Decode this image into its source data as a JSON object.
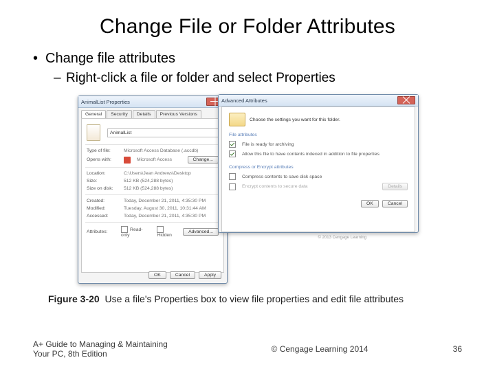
{
  "title": "Change File or Folder Attributes",
  "bullet1": "Change file attributes",
  "bullet2": "Right-click a file or folder and select Properties",
  "props": {
    "winTitle": "AnimalList Properties",
    "tabs": [
      "General",
      "Security",
      "Details",
      "Previous Versions"
    ],
    "nameLabel": "",
    "name": "AnimalList",
    "typeLabel": "Type of file:",
    "type": "Microsoft Access Database (.accdb)",
    "opensLabel": "Opens with:",
    "opens": "Microsoft Access",
    "changeBtn": "Change...",
    "locLabel": "Location:",
    "loc": "C:\\Users\\Jean Andrews\\Desktop",
    "sizeLabel": "Size:",
    "size": "512 KB (524,288 bytes)",
    "diskLabel": "Size on disk:",
    "disk": "512 KB (524,288 bytes)",
    "createdLabel": "Created:",
    "created": "Today, December 21, 2011, 4:35:30 PM",
    "modLabel": "Modified:",
    "mod": "Tuesday, August 30, 2011, 10:31:44 AM",
    "accLabel": "Accessed:",
    "acc": "Today, December 21, 2011, 4:35:30 PM",
    "attrLabel": "Attributes:",
    "ro": "Read-only",
    "hd": "Hidden",
    "advBtn": "Advanced...",
    "ok": "OK",
    "cancel": "Cancel",
    "apply": "Apply"
  },
  "adv": {
    "winTitle": "Advanced Attributes",
    "hdr": "Choose the settings you want for this folder.",
    "sect1": "File attributes",
    "a1": "File is ready for archiving",
    "a2": "Allow this file to have contents indexed in addition to file properties",
    "sect2": "Compress or Encrypt attributes",
    "c1": "Compress contents to save disk space",
    "c2": "Encrypt contents to secure data",
    "details": "Details",
    "ok": "OK",
    "cancel": "Cancel"
  },
  "captionBold": "Figure 3-20",
  "caption": "Use a file's Properties box to view file properties and edit file attributes",
  "credit": "© 2013 Cengage Learning",
  "book1": "A+ Guide to Managing & Maintaining",
  "book2": "Your PC, 8th Edition",
  "copy": "© Cengage Learning 2014",
  "page": "36"
}
